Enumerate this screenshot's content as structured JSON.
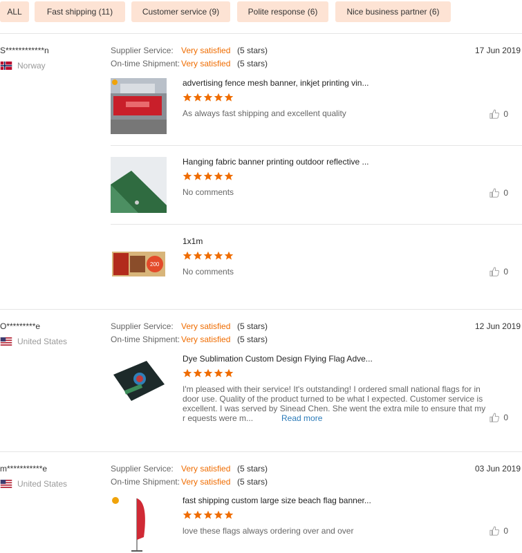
{
  "filters": [
    {
      "label": "ALL"
    },
    {
      "label": "Fast shipping (11)"
    },
    {
      "label": "Customer service (9)"
    },
    {
      "label": "Polite response (6)"
    },
    {
      "label": "Nice business partner (6)"
    }
  ],
  "labels": {
    "supplier_service": "Supplier Service:",
    "ontime_shipment": "On-time Shipment:",
    "read_more": "Read more"
  },
  "colors": {
    "accent": "#ef6c00",
    "chip_bg": "#fde3d4",
    "link": "#2a7ab8"
  },
  "reviews": [
    {
      "user": "S************n",
      "country": "Norway",
      "flag": "norway-flag-icon",
      "supplier_service": "Very satisfied",
      "supplier_stars": "(5 stars)",
      "ontime_shipment": "Very satisfied",
      "ontime_stars": "(5 stars)",
      "date": "17 Jun 2019",
      "items": [
        {
          "title": "advertising fence mesh banner, inkjet printing vin...",
          "rating": 5,
          "comment": "As always fast shipping and excellent quality",
          "likes": "0"
        },
        {
          "title": "Hanging fabric banner printing outdoor reflective ...",
          "rating": 5,
          "comment": "No comments",
          "likes": "0"
        },
        {
          "title": "1x1m",
          "rating": 5,
          "comment": "No comments",
          "likes": "0"
        }
      ]
    },
    {
      "user": "O*********e",
      "country": "United States",
      "flag": "usa-flag-icon",
      "supplier_service": "Very satisfied",
      "supplier_stars": "(5 stars)",
      "ontime_shipment": "Very satisfied",
      "ontime_stars": "(5 stars)",
      "date": "12 Jun 2019",
      "items": [
        {
          "title": "Dye Sublimation Custom Design Flying Flag Adve...",
          "rating": 5,
          "comment": "I'm pleased with their service! It's outstanding! I ordered small national flags for in door use. Quality of the  product turned to be what I expected. Customer service is excellent. I was served by Sinead Chen. She went the extra mile to ensure that my r equests were m...",
          "likes": "0"
        }
      ]
    },
    {
      "user": "m***********e",
      "country": "United States",
      "flag": "usa-flag-icon",
      "supplier_service": "Very satisfied",
      "supplier_stars": "(5 stars)",
      "ontime_shipment": "Very satisfied",
      "ontime_stars": "(5 stars)",
      "date": "03 Jun 2019",
      "items": [
        {
          "title": "fast shipping custom large size beach flag banner...",
          "rating": 5,
          "comment": "love these flags always ordering over and over",
          "likes": "0"
        }
      ]
    }
  ]
}
